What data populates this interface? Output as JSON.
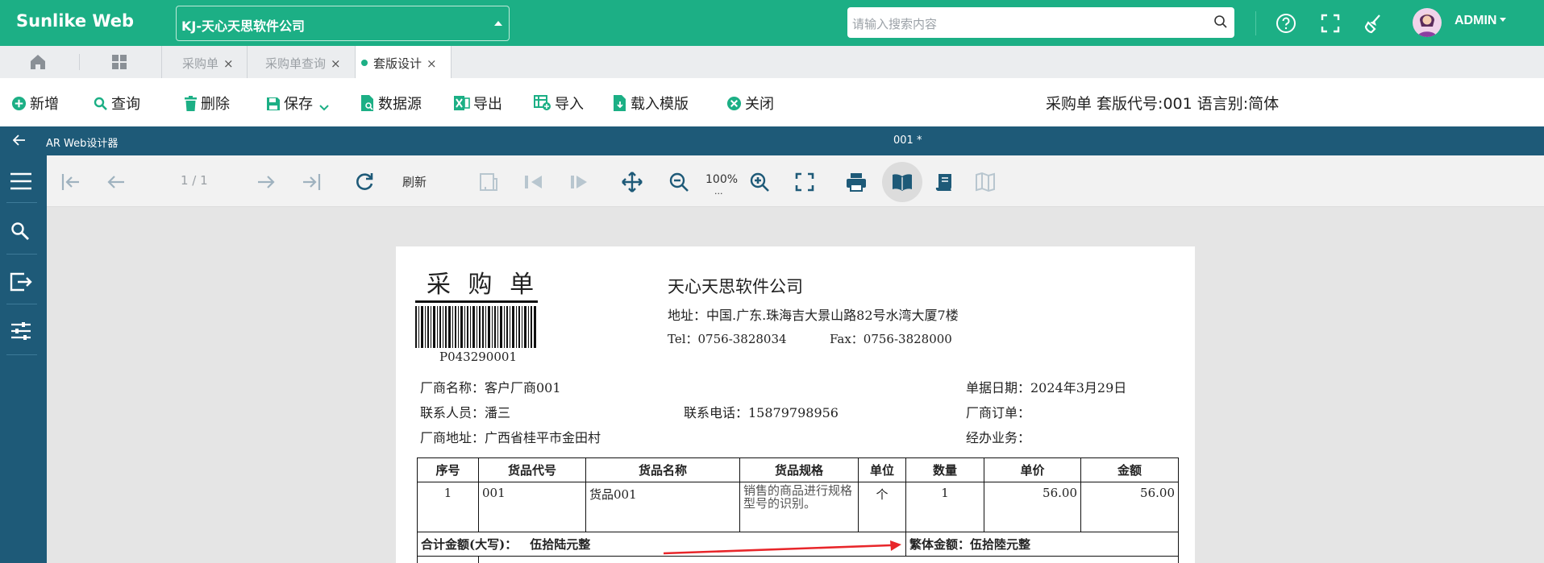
{
  "app": {
    "logo": "Sunlike Web",
    "company": "KJ-天心天思软件公司",
    "search_placeholder": "请输入搜索内容",
    "user": "ADMIN"
  },
  "tabs": [
    {
      "label": "采购单"
    },
    {
      "label": "采购单查询"
    },
    {
      "label": "套版设计"
    }
  ],
  "toolbar": {
    "new": "新增",
    "query": "查询",
    "delete": "删除",
    "save": "保存",
    "datasource": "数据源",
    "export": "导出",
    "import": "导入",
    "load_template": "载入模版",
    "close": "关闭",
    "info": "采购单 套版代号:001 语言别:简体"
  },
  "designer": {
    "title": "AR Web设计器",
    "doc": "001 *",
    "page": "1 / 1",
    "refresh": "刷新",
    "zoom": "100%",
    "zoom_more": "..."
  },
  "report": {
    "title": "采 购 单",
    "barcode": "P043290001",
    "company": "天心天思软件公司",
    "address": "地址：中国.广东.珠海吉大景山路82号水湾大厦7楼",
    "tel": "Tel：0756-3828034",
    "fax": "Fax：0756-3828000",
    "vendor": "厂商名称：客户厂商001",
    "date": "单据日期：2024年3月29日",
    "contact": "联系人员：潘三",
    "phone": "联系电话：15879798956",
    "vendor_order": "厂商订单：",
    "vendor_addr": "厂商地址：广西省桂平市金田村",
    "sales": "经办业务：",
    "headers": [
      "序号",
      "货品代号",
      "货品名称",
      "货品规格",
      "单位",
      "数量",
      "单价",
      "金额"
    ],
    "row": [
      "1",
      "001",
      "货品001",
      "销售的商品进行规格型号的识别。",
      "个",
      "1",
      "56.00",
      "56.00"
    ],
    "total_label": "合计金额(大写)：",
    "total_value": "伍拾陆元整",
    "trad_total": "繁体金额：伍拾陸元整"
  },
  "colors": {
    "brand": "#1caf85",
    "designer": "#1e5a78",
    "arrow": "#e8262a"
  }
}
